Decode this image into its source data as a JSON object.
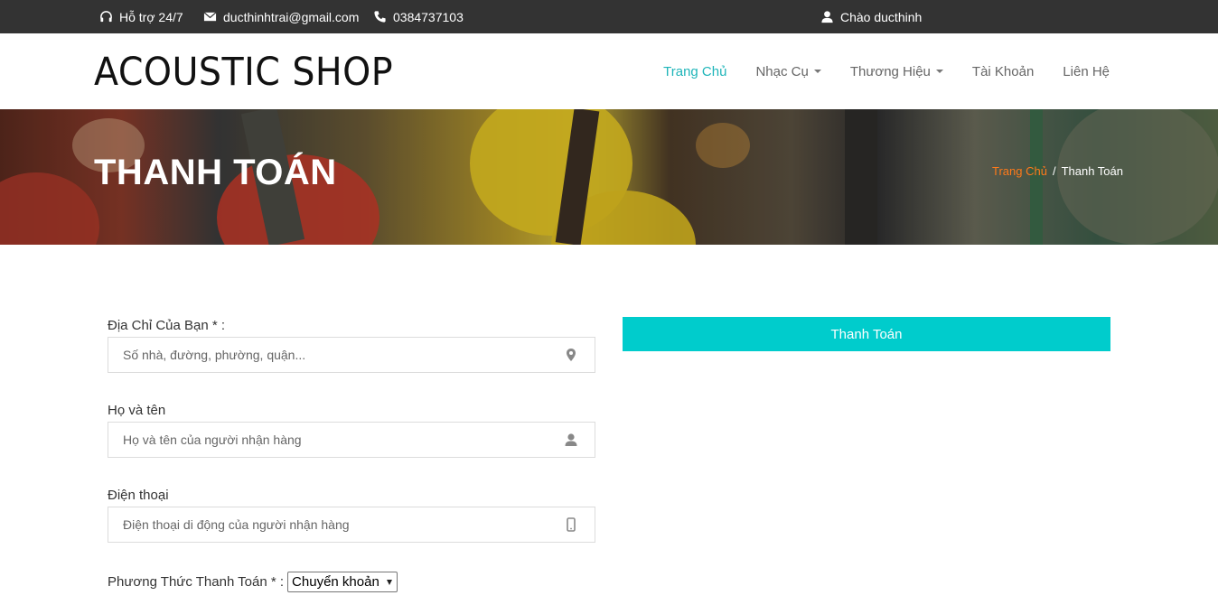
{
  "topbar": {
    "support": "Hỗ trợ 24/7",
    "email": "ducthinhtrai@gmail.com",
    "phone": "0384737103",
    "greeting": "Chào ducthinh"
  },
  "header": {
    "logo": "ACOUSTIC SHOP",
    "nav": [
      {
        "label": "Trang Chủ",
        "active": true
      },
      {
        "label": "Nhạc Cụ",
        "dropdown": true
      },
      {
        "label": "Thương Hiệu",
        "dropdown": true
      },
      {
        "label": "Tài Khoản"
      },
      {
        "label": "Liên Hệ"
      }
    ]
  },
  "banner": {
    "title": "THANH TOÁN",
    "breadcrumb_home": "Trang Chủ",
    "breadcrumb_sep": "/",
    "breadcrumb_current": "Thanh Toán"
  },
  "form": {
    "address_label": "Địa Chỉ Của Bạn * :",
    "address_placeholder": "Số nhà, đường, phường, quận...",
    "name_label": "Họ và tên",
    "name_placeholder": "Họ và tên của người nhận hàng",
    "phone_label": "Điện thoại",
    "phone_placeholder": "Điện thoại di động của người nhận hàng",
    "payment_label": "Phương Thức Thanh Toán * :",
    "payment_selected": "Chuyển khoản"
  },
  "submit_label": "Thanh Toán",
  "colors": {
    "topbar_bg": "#333333",
    "accent_teal": "#00cccc",
    "nav_active": "#1fb5b9",
    "breadcrumb_home": "#ff7a1a"
  }
}
